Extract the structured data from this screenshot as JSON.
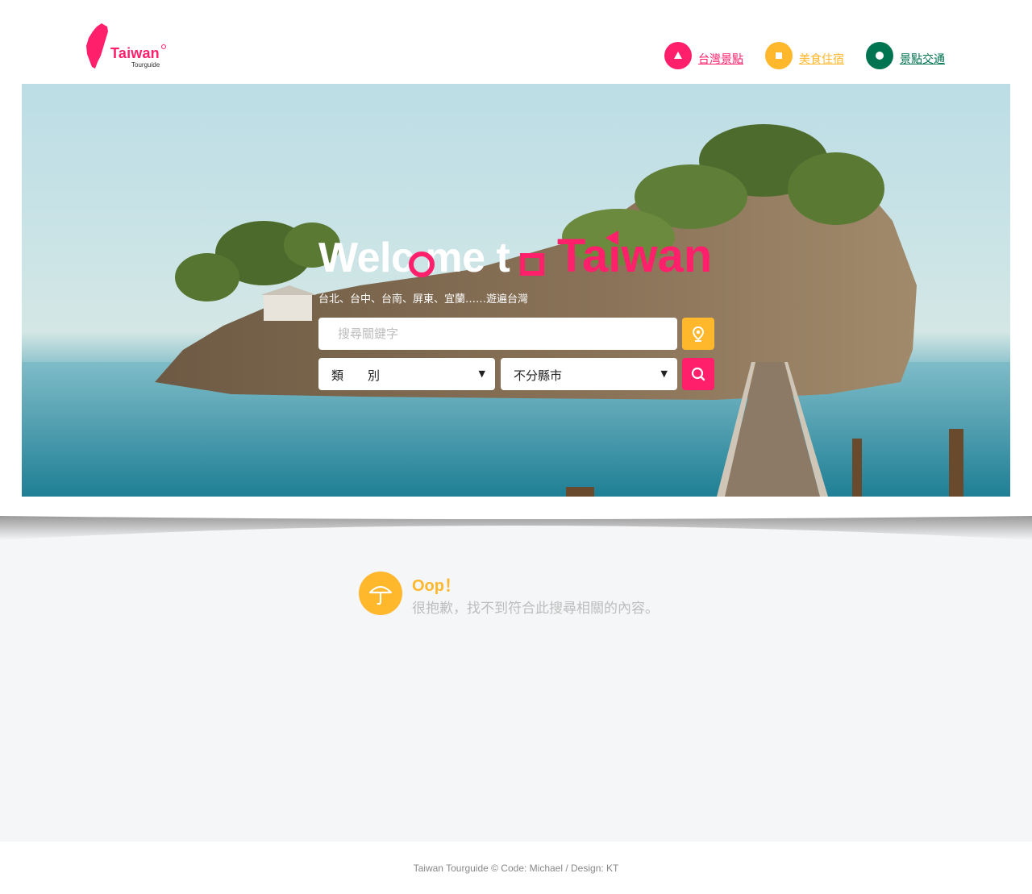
{
  "logo": {
    "title": "Taiwan",
    "subtitle": "Tourguide"
  },
  "nav": [
    {
      "label": "台灣景點",
      "color": "#ff1f6b",
      "icon": "triangle-icon"
    },
    {
      "label": "美食住宿",
      "color": "#ffb72c",
      "icon": "square-icon"
    },
    {
      "label": "景點交通",
      "color": "#007350",
      "icon": "circle-icon"
    }
  ],
  "hero": {
    "title_white": "Welc me t",
    "title_pink": "Taiwan",
    "subtitle": "台北、台中、台南、屏東、宜蘭……遊遍台灣"
  },
  "search": {
    "placeholder": "搜尋關鍵字",
    "category_value": "類　　別",
    "city_value": "不分縣市",
    "location_button_icon": "location-pin-icon",
    "search_button_icon": "search-icon"
  },
  "empty_state": {
    "icon": "umbrella-icon",
    "title": "Oop！",
    "message": "很抱歉，找不到符合此搜尋相關的內容。"
  },
  "footer": {
    "text": "Taiwan Tourguide  © Code: Michael  /  Design: KT"
  },
  "colors": {
    "pink": "#ff1f6b",
    "yellow": "#ffb72c",
    "green": "#007350",
    "background": "#f5f6f8"
  }
}
